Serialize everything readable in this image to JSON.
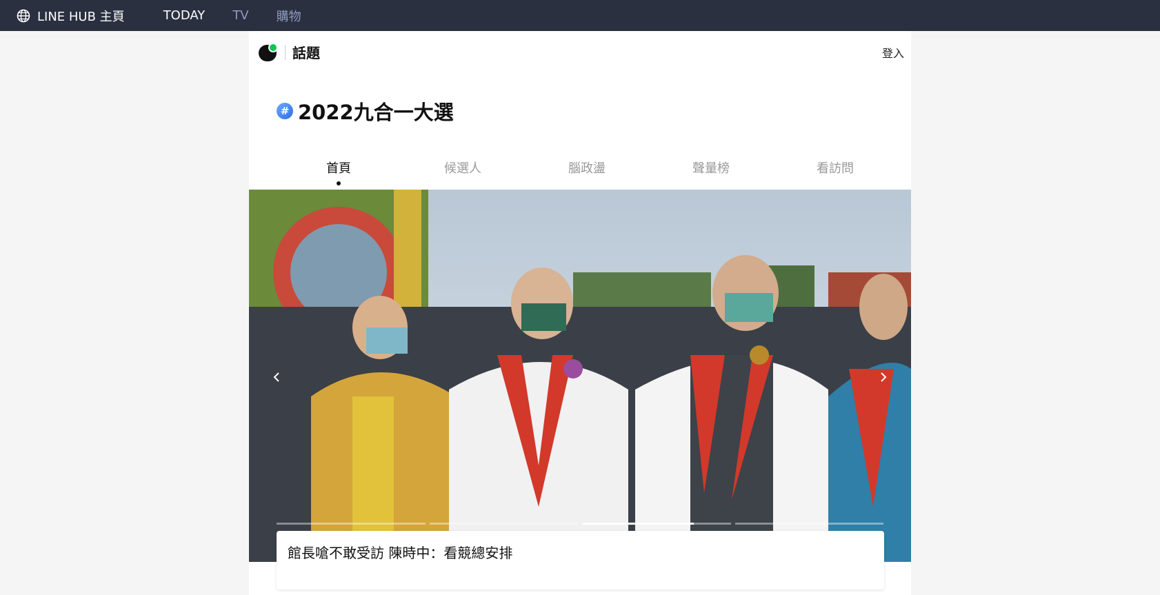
{
  "topbar": {
    "hub_label": "LINE HUB 主頁",
    "nav": [
      {
        "label": "TODAY",
        "active": true
      },
      {
        "label": "TV",
        "active": false
      },
      {
        "label": "購物",
        "active": false
      }
    ]
  },
  "header": {
    "section": "話題",
    "login": "登入"
  },
  "topic": {
    "hash_symbol": "#",
    "title": "2022九合一大選"
  },
  "tabs": [
    {
      "label": "首頁",
      "active": true
    },
    {
      "label": "候選人",
      "active": false
    },
    {
      "label": "腦政盪",
      "active": false
    },
    {
      "label": "聲量榜",
      "active": false
    },
    {
      "label": "看訪問",
      "active": false
    }
  ],
  "carousel": {
    "prev_icon": "chevron-left-icon",
    "next_icon": "chevron-right-icon",
    "slides": 4,
    "current_slide": 3,
    "current_progress": 0.75,
    "caption": "館長嗆不敢受訪 陳時中：看競總安排"
  },
  "colors": {
    "topbar_bg": "#2b3040",
    "accent_green": "#06c755",
    "nav_inactive": "#8f9bbf"
  }
}
